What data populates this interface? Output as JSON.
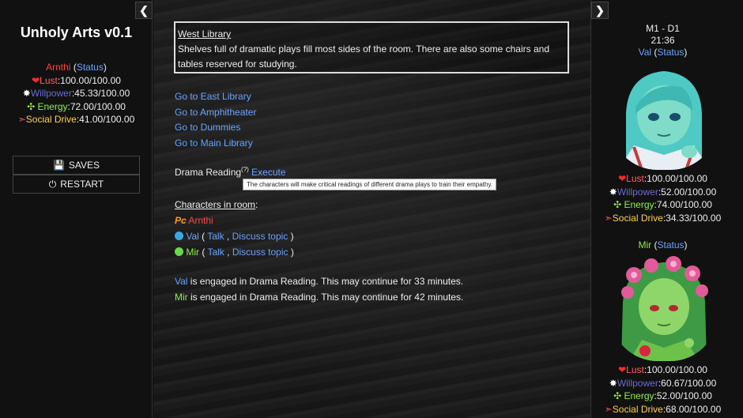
{
  "game": {
    "title": "Unholy Arts v0.1"
  },
  "left": {
    "player": {
      "name": "Arnthi",
      "status_link": "Status"
    },
    "stats": [
      {
        "label": "Lust",
        "value": "100.00/100.00"
      },
      {
        "label": "Willpower",
        "value": "45.33/100.00"
      },
      {
        "label": "Energy",
        "value": "72.00/100.00"
      },
      {
        "label": "Social Drive",
        "value": "41.00/100.00"
      }
    ],
    "menu": {
      "saves": "SAVES",
      "restart": "RESTART"
    }
  },
  "main": {
    "room": {
      "title": "West Library",
      "description": "Shelves full of dramatic plays fill most sides of the room. There are also some chairs and tables reserved for studying."
    },
    "exits": [
      "Go to East Library",
      "Go to Amphitheater",
      "Go to Dummies",
      "Go to Main Library"
    ],
    "activity": {
      "name": "Drama Reading",
      "hint": "(?)",
      "action": "Execute",
      "tooltip": "The characters will make critical readings of different drama plays to train their empathy."
    },
    "characters": {
      "header": "Characters in room",
      "colon": ":",
      "pc_badge": "Pc",
      "player": "Arnthi",
      "talk": "Talk",
      "discuss": "Discuss topic",
      "list": [
        {
          "name": "Val"
        },
        {
          "name": "Mir"
        }
      ]
    },
    "engaged": [
      {
        "name": "Val",
        "text": " is engaged in Drama Reading. This may continue for 33 minutes."
      },
      {
        "name": "Mir",
        "text": " is engaged in Drama Reading. This may continue for 42 minutes."
      }
    ]
  },
  "right": {
    "date": "M1 - D1",
    "clock": "21:36",
    "status_link": "Status",
    "companions": [
      {
        "name": "Val",
        "stats": [
          {
            "label": "Lust",
            "value": "100.00/100.00"
          },
          {
            "label": "Willpower",
            "value": "52.00/100.00"
          },
          {
            "label": "Energy",
            "value": "74.00/100.00"
          },
          {
            "label": "Social Drive",
            "value": "34.33/100.00"
          }
        ]
      },
      {
        "name": "Mir",
        "stats": [
          {
            "label": "Lust",
            "value": "100.00/100.00"
          },
          {
            "label": "Willpower",
            "value": "60.67/100.00"
          },
          {
            "label": "Energy",
            "value": "52.00/100.00"
          },
          {
            "label": "Social Drive",
            "value": "68.00/100.00"
          }
        ]
      }
    ]
  },
  "colors": {
    "link": "#68a3ff",
    "player": "#ff4040",
    "energy": "#8ef04b",
    "social": "#ffd24a",
    "willpower": "#6a6ad6"
  }
}
